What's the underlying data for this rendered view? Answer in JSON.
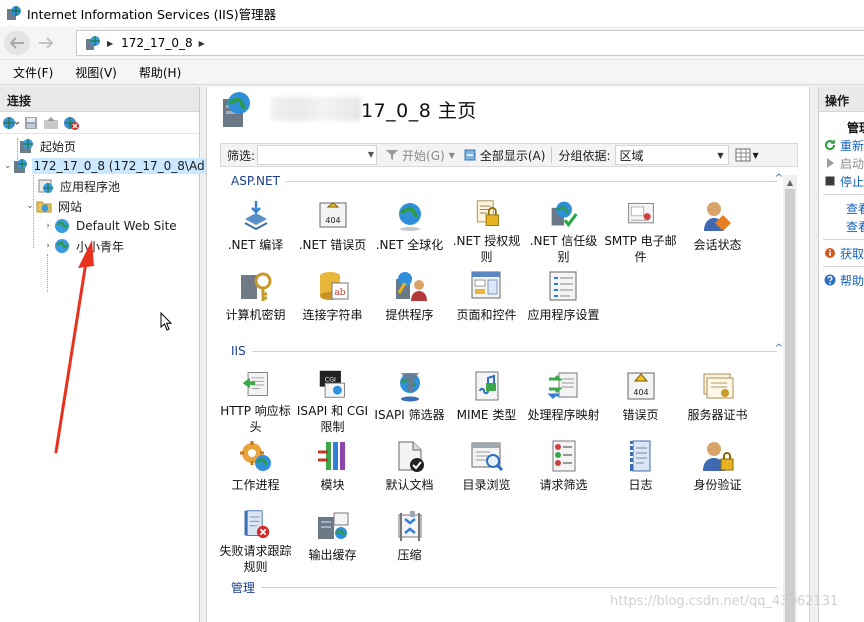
{
  "window": {
    "title": "Internet Information Services (IIS)管理器"
  },
  "address": {
    "path": "172_17_0_8",
    "back_icon": "back-arrow-icon",
    "forward_icon": "forward-arrow-icon"
  },
  "menu": {
    "items": [
      "文件(F)",
      "视图(V)",
      "帮助(H)"
    ]
  },
  "connections": {
    "header": "连接",
    "tree": {
      "start_page": "起始页",
      "server": "172_17_0_8 (172_17_0_8\\Ad",
      "app_pools": "应用程序池",
      "sites": "网站",
      "site1": "Default Web Site",
      "site2": "小小青年"
    }
  },
  "main": {
    "title_suffix": "17_0_8 主页",
    "filter": {
      "label": "筛选:",
      "go_label": "开始(G)",
      "show_all_label": "全部显示(A)",
      "group_by_label": "分组依据:",
      "group_by_value": "区域"
    },
    "sections": {
      "aspnet": {
        "name": "ASP.NET",
        "features": [
          {
            "label": ".NET 编译",
            "icon": "net-compile-icon"
          },
          {
            "label": ".NET 错误页",
            "icon": "net-error-page-icon"
          },
          {
            "label": ".NET 全球化",
            "icon": "net-globalization-icon"
          },
          {
            "label": ".NET 授权规则",
            "icon": "net-authorization-icon"
          },
          {
            "label": ".NET 信任级别",
            "icon": "net-trust-icon"
          },
          {
            "label": "SMTP 电子邮件",
            "icon": "smtp-email-icon"
          },
          {
            "label": "会话状态",
            "icon": "session-state-icon"
          },
          {
            "label": "计算机密钥",
            "icon": "machine-key-icon"
          },
          {
            "label": "连接字符串",
            "icon": "connection-strings-icon"
          },
          {
            "label": "提供程序",
            "icon": "providers-icon"
          },
          {
            "label": "页面和控件",
            "icon": "pages-controls-icon"
          },
          {
            "label": "应用程序设置",
            "icon": "app-settings-icon"
          }
        ]
      },
      "iis": {
        "name": "IIS",
        "features": [
          {
            "label": "HTTP 响应标头",
            "icon": "http-headers-icon"
          },
          {
            "label": "ISAPI 和 CGI 限制",
            "icon": "isapi-cgi-icon"
          },
          {
            "label": "ISAPI 筛选器",
            "icon": "isapi-filters-icon"
          },
          {
            "label": "MIME 类型",
            "icon": "mime-types-icon"
          },
          {
            "label": "处理程序映射",
            "icon": "handler-mappings-icon"
          },
          {
            "label": "错误页",
            "icon": "error-pages-icon"
          },
          {
            "label": "服务器证书",
            "icon": "server-certificates-icon"
          },
          {
            "label": "工作进程",
            "icon": "worker-processes-icon"
          },
          {
            "label": "模块",
            "icon": "modules-icon"
          },
          {
            "label": "默认文档",
            "icon": "default-document-icon"
          },
          {
            "label": "目录浏览",
            "icon": "directory-browsing-icon"
          },
          {
            "label": "请求筛选",
            "icon": "request-filtering-icon"
          },
          {
            "label": "日志",
            "icon": "logging-icon"
          },
          {
            "label": "身份验证",
            "icon": "authentication-icon"
          },
          {
            "label": "失败请求跟踪规则",
            "icon": "failed-request-tracing-icon"
          },
          {
            "label": "输出缓存",
            "icon": "output-caching-icon"
          },
          {
            "label": "压缩",
            "icon": "compression-icon"
          }
        ]
      },
      "management": {
        "name": "管理"
      }
    }
  },
  "actions": {
    "header": "操作",
    "items": [
      {
        "label": "管理",
        "kind": "head"
      },
      {
        "label": "重新",
        "kind": "link",
        "icon": "restart-icon"
      },
      {
        "label": "启动",
        "kind": "disabled",
        "icon": "start-icon"
      },
      {
        "label": "停止",
        "kind": "link",
        "icon": "stop-icon"
      },
      {
        "label": "查看",
        "kind": "link"
      },
      {
        "label": "查看",
        "kind": "link"
      },
      {
        "label": "获取",
        "kind": "link",
        "icon": "info-icon"
      },
      {
        "label": "帮助",
        "kind": "link",
        "icon": "help-icon"
      }
    ]
  },
  "watermark": "https://blog.csdn.net/qq_43062131",
  "colors": {
    "accent_link": "#1764bf",
    "section_title": "#1a3e8b",
    "selection": "#cce8ff",
    "annotation_arrow": "#e8321e"
  }
}
